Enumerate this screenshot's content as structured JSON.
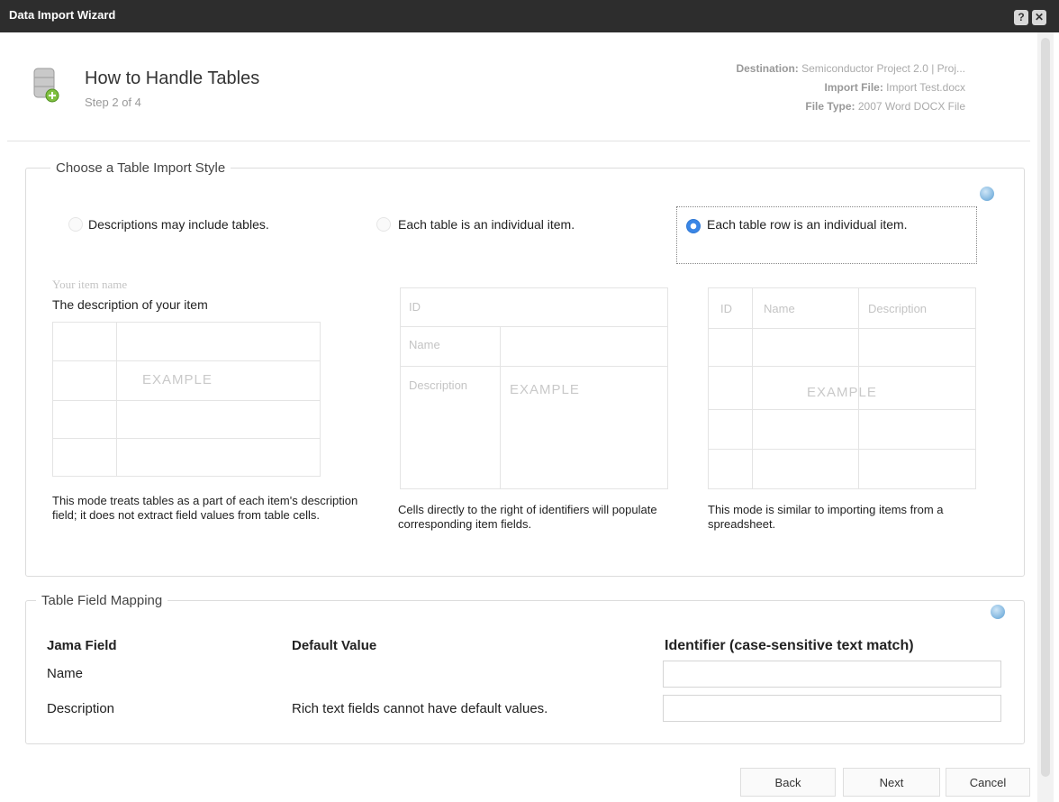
{
  "window": {
    "title": "Data Import Wizard",
    "help_glyph": "?",
    "close_glyph": "✕"
  },
  "header": {
    "title": "How to Handle Tables",
    "step": "Step 2 of 4",
    "destination_label": "Destination:",
    "destination_value": "Semiconductor Project 2.0 | Proj...",
    "import_file_label": "Import File:",
    "import_file_value": "Import Test.docx",
    "file_type_label": "File Type:",
    "file_type_value": "2007 Word DOCX File"
  },
  "import_style": {
    "legend": "Choose a Table Import Style",
    "options": [
      {
        "label": "Descriptions may include tables.",
        "checked": false
      },
      {
        "label": "Each table is an individual item.",
        "checked": false
      },
      {
        "label": "Each table row is an individual item.",
        "checked": true
      }
    ],
    "example1": {
      "item_name": "Your item name",
      "item_desc": "The description of your item",
      "example_word": "EXAMPLE",
      "caption": "This mode treats tables as a part of each item's description field; it does not extract field values from table cells."
    },
    "example2": {
      "id": "ID",
      "name": "Name",
      "description": "Description",
      "example_word": "EXAMPLE",
      "caption": "Cells directly to the right of identifiers will populate corresponding item fields."
    },
    "example3": {
      "id": "ID",
      "name": "Name",
      "description": "Description",
      "example_word": "EXAMPLE",
      "caption": "This mode is similar to importing items from a spreadsheet."
    }
  },
  "mapping": {
    "legend": "Table Field Mapping",
    "col_field": "Jama Field",
    "col_default": "Default Value",
    "col_identifier": "Identifier (case-sensitive text match)",
    "rows": [
      {
        "field": "Name",
        "default": "",
        "identifier": ""
      },
      {
        "field": "Description",
        "default": "Rich text fields cannot have default values.",
        "identifier": ""
      }
    ]
  },
  "footer": {
    "back": "Back",
    "next": "Next",
    "cancel": "Cancel"
  },
  "colors": {
    "titlebar": "#2d2d2d",
    "radio_selected": "#3a86e6"
  }
}
